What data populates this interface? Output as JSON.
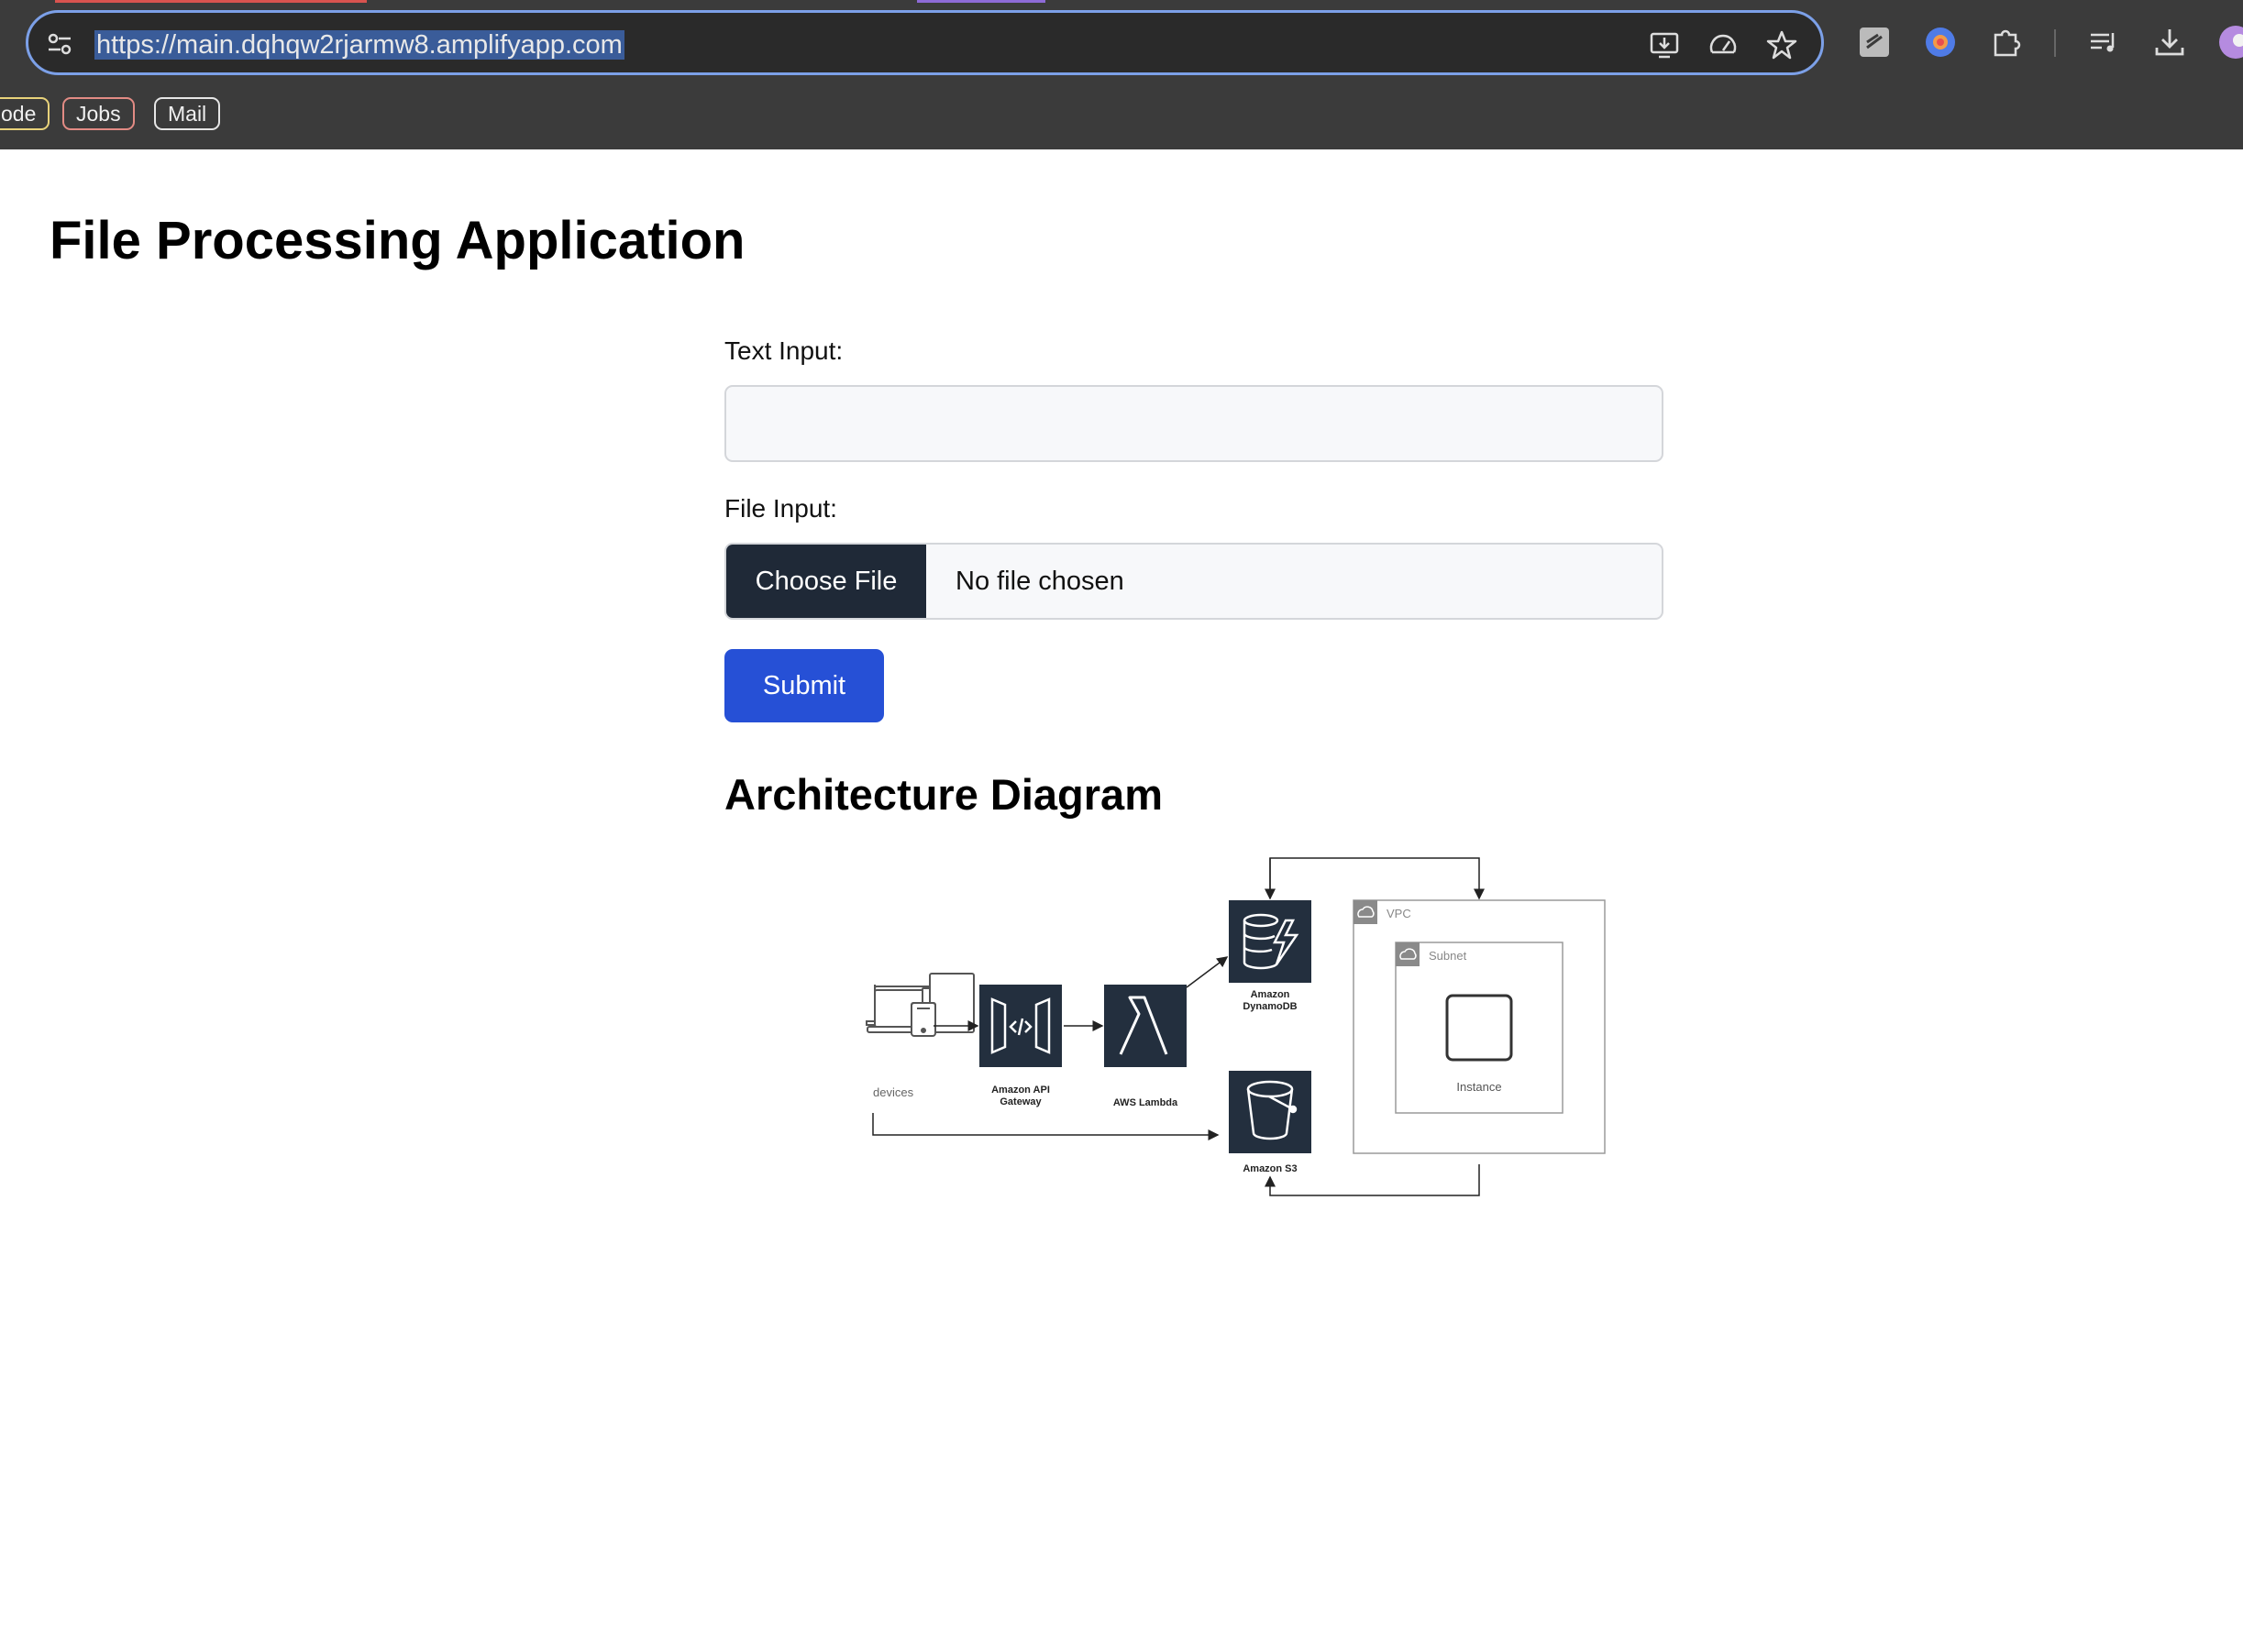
{
  "browser": {
    "url_highlighted": "https://main.dqhqw2rjarmw8.amplifyapp.com",
    "bookmarks": [
      {
        "label": "ode",
        "color": "#e8d27a"
      },
      {
        "label": "Jobs",
        "color": "#e28b84"
      },
      {
        "label": "Mail",
        "color": "#e6e6e6"
      }
    ],
    "accent": "#7ca0e8"
  },
  "page": {
    "title": "File Processing Application",
    "text_input_label": "Text Input:",
    "text_input_value": "",
    "file_input_label": "File Input:",
    "choose_file_label": "Choose File",
    "no_file_text": "No file chosen",
    "submit_label": "Submit",
    "diagram_heading": "Architecture Diagram",
    "submit_color": "#2650d6"
  },
  "diagram": {
    "devices": "devices",
    "api_gateway_line1": "Amazon API",
    "api_gateway_line2": "Gateway",
    "lambda": "AWS Lambda",
    "dynamodb_line1": "Amazon",
    "dynamodb_line2": "DynamoDB",
    "s3": "Amazon S3",
    "vpc": "VPC",
    "subnet": "Subnet",
    "instance": "Instance"
  }
}
